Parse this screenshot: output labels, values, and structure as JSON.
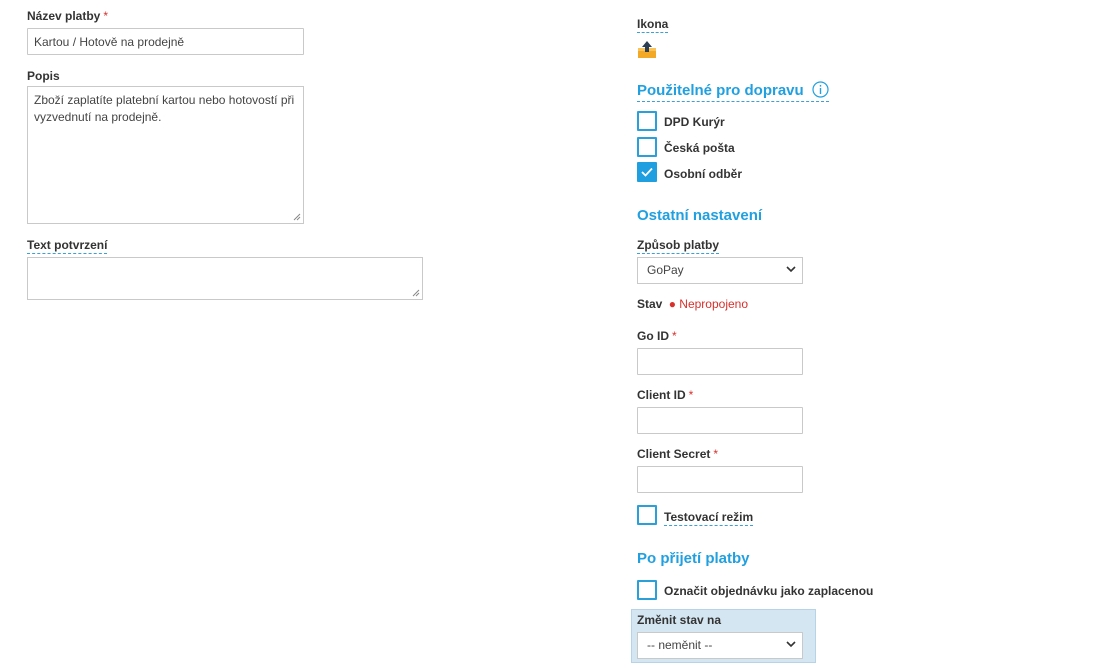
{
  "left": {
    "name_label": "Název platby",
    "name_required": "*",
    "name_value": "Kartou / Hotově na prodejně",
    "desc_label": "Popis",
    "desc_value": "Zboží zaplatíte platební kartou nebo hotovostí při vyzvednutí na prodejně.",
    "confirm_label": "Text potvrzení",
    "confirm_value": ""
  },
  "right": {
    "icon_label": "Ikona",
    "icon_name": "upload-box-icon",
    "shipping_title": "Použitelné pro dopravu",
    "info_icon": "info-icon",
    "shipping_options": [
      {
        "label": "DPD Kurýr",
        "checked": false
      },
      {
        "label": "Česká pošta",
        "checked": false
      },
      {
        "label": "Osobní odběr",
        "checked": true
      }
    ],
    "other_title": "Ostatní nastavení",
    "payment_method_label": "Způsob platby",
    "payment_method_value": "GoPay",
    "status_label": "Stav",
    "status_value": "Nepropojeno",
    "status_color": "#d9302c",
    "goid_label": "Go ID",
    "client_id_label": "Client ID",
    "client_secret_label": "Client Secret",
    "required_mark": "*",
    "test_mode_label": "Testovací režim",
    "after_payment_title": "Po přijetí platby",
    "mark_paid_label": "Označit objednávku jako zaplacenou",
    "change_status_label": "Změnit stav na",
    "change_status_value": "-- neměnit --"
  },
  "colors": {
    "accent": "#20a0e0",
    "required": "#d9302c",
    "highlight_bg": "#d4e6f2"
  }
}
